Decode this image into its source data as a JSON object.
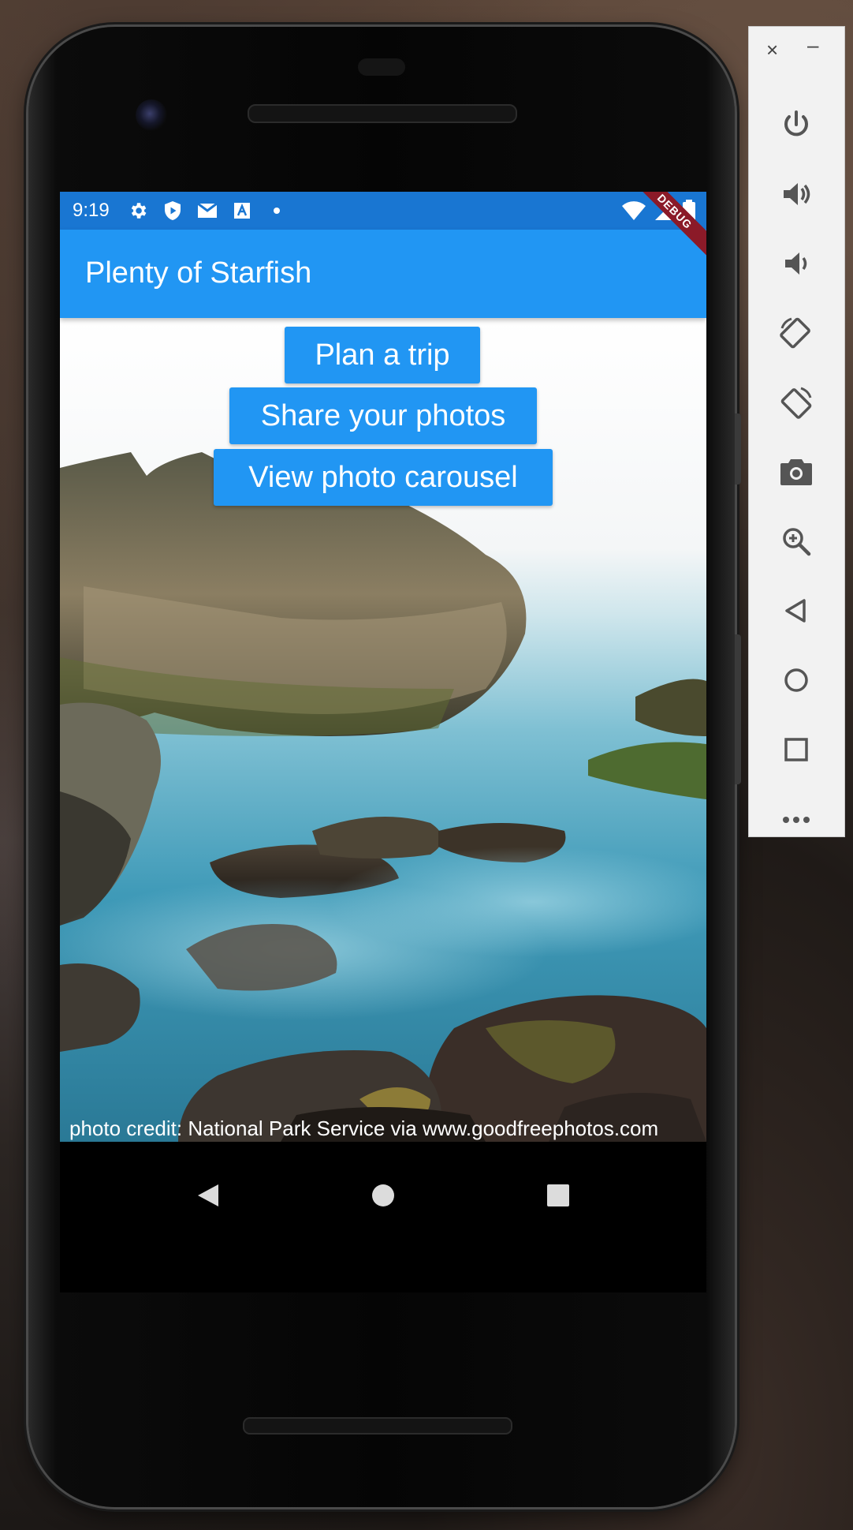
{
  "status_bar": {
    "time": "9:19",
    "icons_left": [
      "settings-icon",
      "shield-play-icon",
      "gmail-icon",
      "font-download-icon",
      "notification-dot-icon"
    ],
    "icons_right": [
      "wifi-icon",
      "signal-icon",
      "battery-icon"
    ],
    "debug_banner": "DEBUG"
  },
  "app_bar": {
    "title": "Plenty of Starfish"
  },
  "buttons": {
    "plan_trip": "Plan a trip",
    "share_photos": "Share your photos",
    "view_carousel": "View photo carousel"
  },
  "photo_credit": "photo credit: National Park Service via www.goodfreephotos.com",
  "nav_bar": {
    "buttons": [
      "back-icon",
      "home-icon",
      "recents-icon"
    ]
  },
  "emulator_panel": {
    "window_controls": {
      "close": "×",
      "minimize": "–"
    },
    "tools": [
      "power-icon",
      "volume-up-icon",
      "volume-down-icon",
      "rotate-left-icon",
      "rotate-right-icon",
      "screenshot-icon",
      "zoom-icon",
      "back-icon",
      "home-icon",
      "overview-icon",
      "more-icon"
    ]
  },
  "colors": {
    "status_bar": "#1976d2",
    "app_bar": "#2196f3",
    "button": "#2196f3",
    "debug_ribbon": "#8b1a28"
  }
}
